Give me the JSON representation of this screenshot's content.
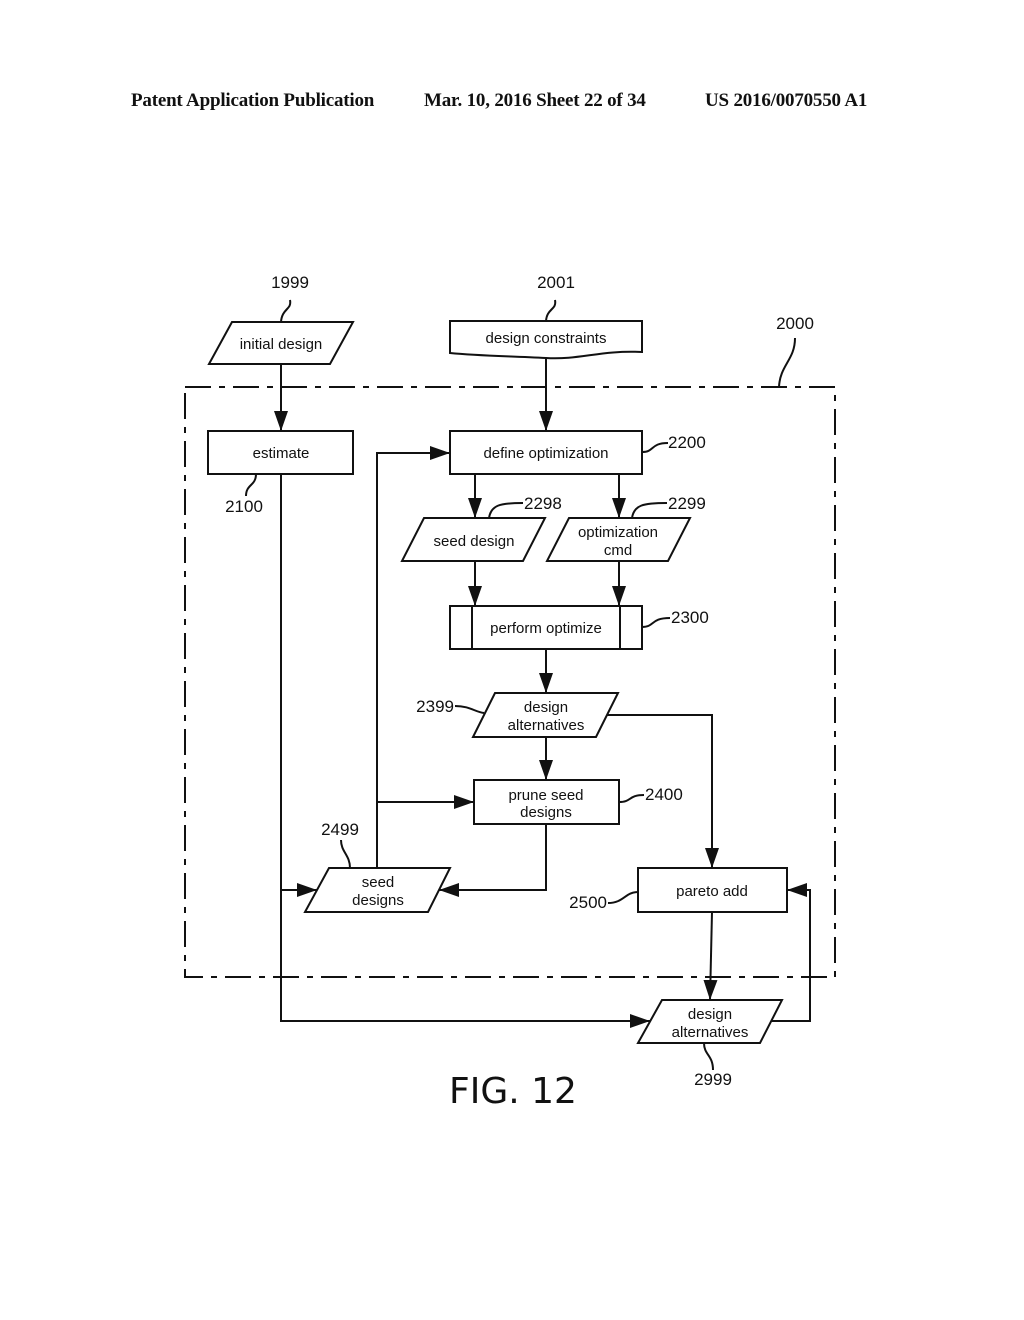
{
  "header": {
    "publication": "Patent Application Publication",
    "date_sheet": "Mar. 10, 2016  Sheet 22 of 34",
    "patent_number": "US 2016/0070550 A1"
  },
  "figure_label": "FIG. 12",
  "boundary": {
    "ref": "2000"
  },
  "nodes": {
    "initial_design": {
      "ref": "1999",
      "shape": "parallelogram",
      "lines": [
        "initial design"
      ]
    },
    "design_constraints": {
      "ref": "2001",
      "shape": "document",
      "lines": [
        "design constraints"
      ]
    },
    "estimate": {
      "ref": "2100",
      "shape": "rectangle",
      "lines": [
        "estimate"
      ]
    },
    "define_optimization": {
      "ref": "2200",
      "shape": "rectangle",
      "lines": [
        "define optimization"
      ]
    },
    "seed_design": {
      "ref": "2298",
      "shape": "parallelogram",
      "lines": [
        "seed design"
      ]
    },
    "optimization_cmd": {
      "ref": "2299",
      "shape": "parallelogram",
      "lines": [
        "optimization",
        "cmd"
      ]
    },
    "perform_optimize": {
      "ref": "2300",
      "shape": "predefined-process",
      "lines": [
        "perform optimize"
      ]
    },
    "design_alternatives_inner": {
      "ref": "2399",
      "shape": "parallelogram",
      "lines": [
        "design",
        "alternatives"
      ]
    },
    "prune_seed_designs": {
      "ref": "2400",
      "shape": "rectangle",
      "lines": [
        "prune seed",
        "designs"
      ]
    },
    "seed_designs": {
      "ref": "2499",
      "shape": "parallelogram",
      "lines": [
        "seed",
        "designs"
      ]
    },
    "pareto_add": {
      "ref": "2500",
      "shape": "rectangle",
      "lines": [
        "pareto add"
      ]
    },
    "design_alternatives_outer": {
      "ref": "2999",
      "shape": "parallelogram",
      "lines": [
        "design",
        "alternatives"
      ]
    }
  },
  "edges": [
    {
      "from": "initial_design",
      "to": "estimate"
    },
    {
      "from": "design_constraints",
      "to": "define_optimization"
    },
    {
      "from": "define_optimization",
      "to": "seed_design"
    },
    {
      "from": "define_optimization",
      "to": "optimization_cmd"
    },
    {
      "from": "seed_design",
      "to": "perform_optimize"
    },
    {
      "from": "optimization_cmd",
      "to": "perform_optimize"
    },
    {
      "from": "perform_optimize",
      "to": "design_alternatives_inner"
    },
    {
      "from": "design_alternatives_inner",
      "to": "prune_seed_designs"
    },
    {
      "from": "design_alternatives_inner",
      "to": "pareto_add"
    },
    {
      "from": "prune_seed_designs",
      "to": "seed_designs"
    },
    {
      "from": "seed_designs",
      "to": "prune_seed_designs"
    },
    {
      "from": "seed_designs",
      "to": "define_optimization"
    },
    {
      "from": "estimate",
      "to": "seed_designs"
    },
    {
      "from": "estimate",
      "to": "design_alternatives_outer"
    },
    {
      "from": "pareto_add",
      "to": "design_alternatives_outer"
    },
    {
      "from": "design_alternatives_outer",
      "to": "pareto_add"
    }
  ]
}
